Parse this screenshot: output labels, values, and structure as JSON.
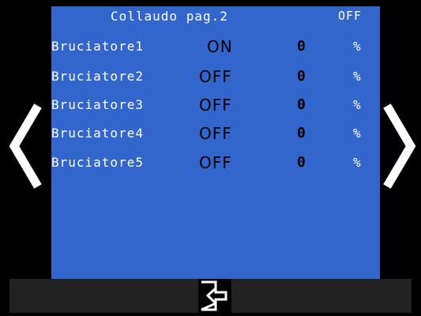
{
  "header": {
    "title": "Collaudo pag.2",
    "status": "OFF"
  },
  "rows": [
    {
      "name": "Bruciatore1",
      "state": "ON",
      "value": "0",
      "unit": "%"
    },
    {
      "name": "Bruciatore2",
      "state": "OFF",
      "value": "0",
      "unit": "%"
    },
    {
      "name": "Bruciatore3",
      "state": "OFF",
      "value": "0",
      "unit": "%"
    },
    {
      "name": "Bruciatore4",
      "state": "OFF",
      "value": "0",
      "unit": "%"
    },
    {
      "name": "Bruciatore5",
      "state": "OFF",
      "value": "0",
      "unit": "%"
    }
  ],
  "nav": {
    "prev_icon": "chevron-left-icon",
    "next_icon": "chevron-right-icon",
    "exit_icon": "exit-icon"
  },
  "colors": {
    "panel": "#3366cc",
    "background": "#000000",
    "bar": "#222222"
  }
}
